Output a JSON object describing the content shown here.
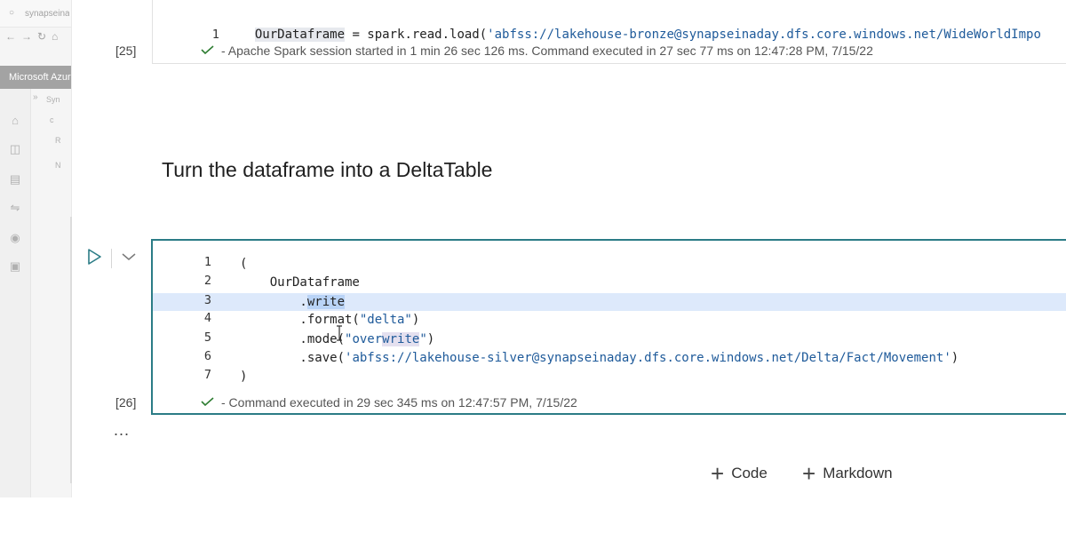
{
  "background": {
    "tab_title": "synapseinaday",
    "brand_banner": "Microsoft Azure",
    "workspace_crumb": "Syn",
    "item_crumb": "c",
    "tree_item": "R",
    "tree_item2": "N"
  },
  "cells": {
    "cell_25": {
      "exec_count": "[25]",
      "lines": [
        {
          "num": "1",
          "var": "OurDataframe",
          "rest": " = spark.read.load(",
          "str": "'abfss://lakehouse-bronze@synapseinaday.dfs.core.windows.net/WideWorldImpo"
        }
      ],
      "status": "- Apache Spark session started in 1 min 26 sec 126 ms. Command executed in 27 sec 77 ms on 12:47:28 PM, 7/15/22"
    },
    "heading": "Turn the dataframe into a DeltaTable",
    "cell_26": {
      "exec_count": "[26]",
      "lines": [
        {
          "num": "1",
          "text": "("
        },
        {
          "num": "2",
          "text": "    OurDataframe"
        },
        {
          "num": "3",
          "pre": "        .",
          "sel": "write"
        },
        {
          "num": "4",
          "pre": "        .format(",
          "str": "\"delta\"",
          "post": ")"
        },
        {
          "num": "5",
          "pre": "        .mode(",
          "str_a": "\"over",
          "str_b": "write",
          "str_c": "\"",
          "post": ")"
        },
        {
          "num": "6",
          "pre": "        .save(",
          "str": "'abfss://lakehouse-silver@synapseinaday.dfs.core.windows.net/Delta/Fact/Movement'",
          "post": ")"
        },
        {
          "num": "7",
          "text": ")"
        }
      ],
      "status": "- Command executed in 29 sec 345 ms on 12:47:57 PM, 7/15/22"
    }
  },
  "toolbar": {
    "more": "...",
    "add_code_label": "Code",
    "add_markdown_label": "Markdown"
  },
  "colors": {
    "active_cell_border": "#2b7c86",
    "success_check": "#2e7d32",
    "string": "#1e5a9a",
    "selection": "#b9d3f6"
  }
}
